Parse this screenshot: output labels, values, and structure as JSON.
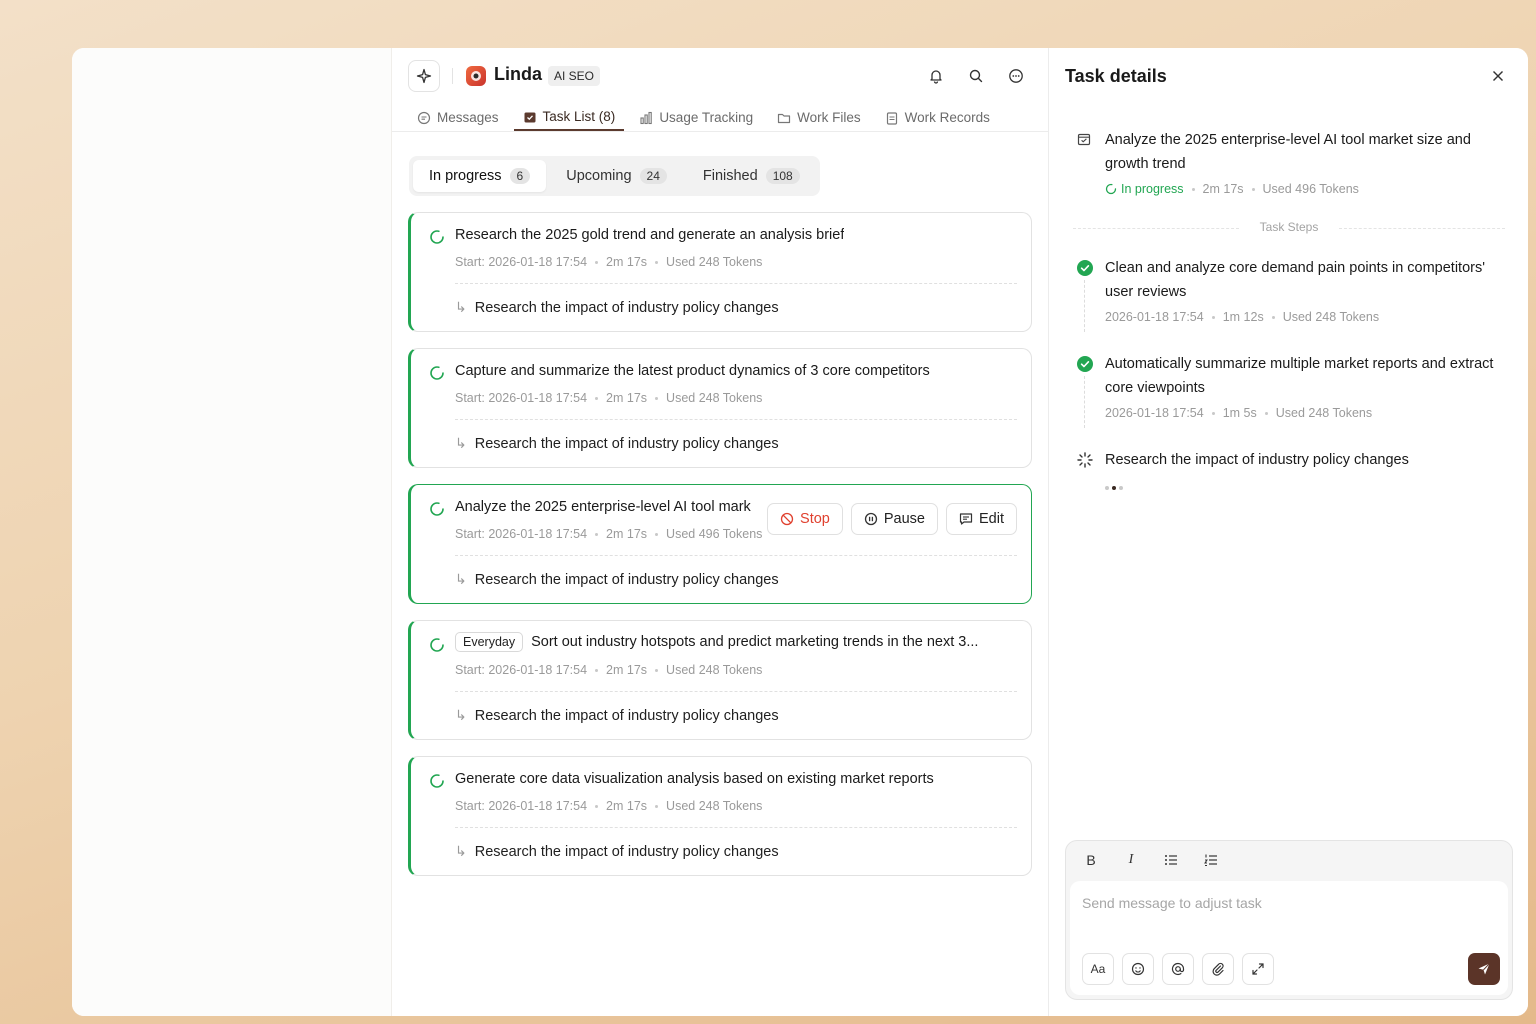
{
  "agent": {
    "name": "Linda",
    "tag": "AI SEO"
  },
  "tabs": [
    {
      "label": "Messages",
      "icon": "chat-icon"
    },
    {
      "label": "Task List (8)",
      "icon": "calendar-check-icon",
      "active": true
    },
    {
      "label": "Usage Tracking",
      "icon": "bar-chart-icon"
    },
    {
      "label": "Work Files",
      "icon": "folder-icon"
    },
    {
      "label": "Work Records",
      "icon": "clipboard-icon"
    }
  ],
  "filter": [
    {
      "label": "In progress",
      "count": "6",
      "active": true
    },
    {
      "label": "Upcoming",
      "count": "24"
    },
    {
      "label": "Finished",
      "count": "108"
    }
  ],
  "tasks": [
    {
      "title": "Research the 2025 gold trend and generate an analysis brief",
      "start": "Start: 2026-01-18 17:54",
      "duration": "2m 17s",
      "tokens": "Used 248 Tokens",
      "sub": "Research the impact of industry policy changes"
    },
    {
      "title": "Capture and summarize the latest product dynamics of 3 core competitors",
      "start": "Start: 2026-01-18 17:54",
      "duration": "2m 17s",
      "tokens": "Used 248 Tokens",
      "sub": "Research the impact of industry policy changes"
    },
    {
      "title": "Analyze the 2025 enterprise-level AI tool mark",
      "start": "Start: 2026-01-18 17:54",
      "duration": "2m 17s",
      "tokens": "Used 496 Tokens",
      "sub": "Research the impact of industry policy changes",
      "selected": true
    },
    {
      "badge": "Everyday",
      "title": "Sort out industry hotspots and predict marketing trends in the next 3...",
      "start": "Start: 2026-01-18 17:54",
      "duration": "2m 17s",
      "tokens": "Used 248 Tokens",
      "sub": "Research the impact of industry policy changes"
    },
    {
      "title": "Generate core data visualization analysis based on existing market reports",
      "start": "Start: 2026-01-18 17:54",
      "duration": "2m 17s",
      "tokens": "Used 248 Tokens",
      "sub": "Research the impact of industry policy changes"
    }
  ],
  "actions": {
    "stop": "Stop",
    "pause": "Pause",
    "edit": "Edit"
  },
  "details": {
    "title": "Task details",
    "task_title": "Analyze the 2025 enterprise-level AI tool market size and growth trend",
    "status": "In progress",
    "duration": "2m 17s",
    "tokens": "Used 496 Tokens",
    "steps_label": "Task Steps",
    "steps": [
      {
        "title": "Clean and analyze core demand pain points in competitors' user reviews",
        "time": "2026-01-18 17:54",
        "duration": "1m 12s",
        "tokens": "Used 248 Tokens",
        "state": "done"
      },
      {
        "title": "Automatically summarize multiple market reports and extract core viewpoints",
        "time": "2026-01-18 17:54",
        "duration": "1m 5s",
        "tokens": "Used 248 Tokens",
        "state": "done"
      },
      {
        "title": "Research the impact of industry policy changes",
        "state": "running"
      }
    ]
  },
  "composer": {
    "placeholder": "Send message to adjust task",
    "format_buttons": [
      "B",
      "I"
    ],
    "font_button": "Aa"
  },
  "colors": {
    "accent_green": "#22a652",
    "brand_brown": "#5b3428",
    "stop_red": "#e0412f"
  }
}
